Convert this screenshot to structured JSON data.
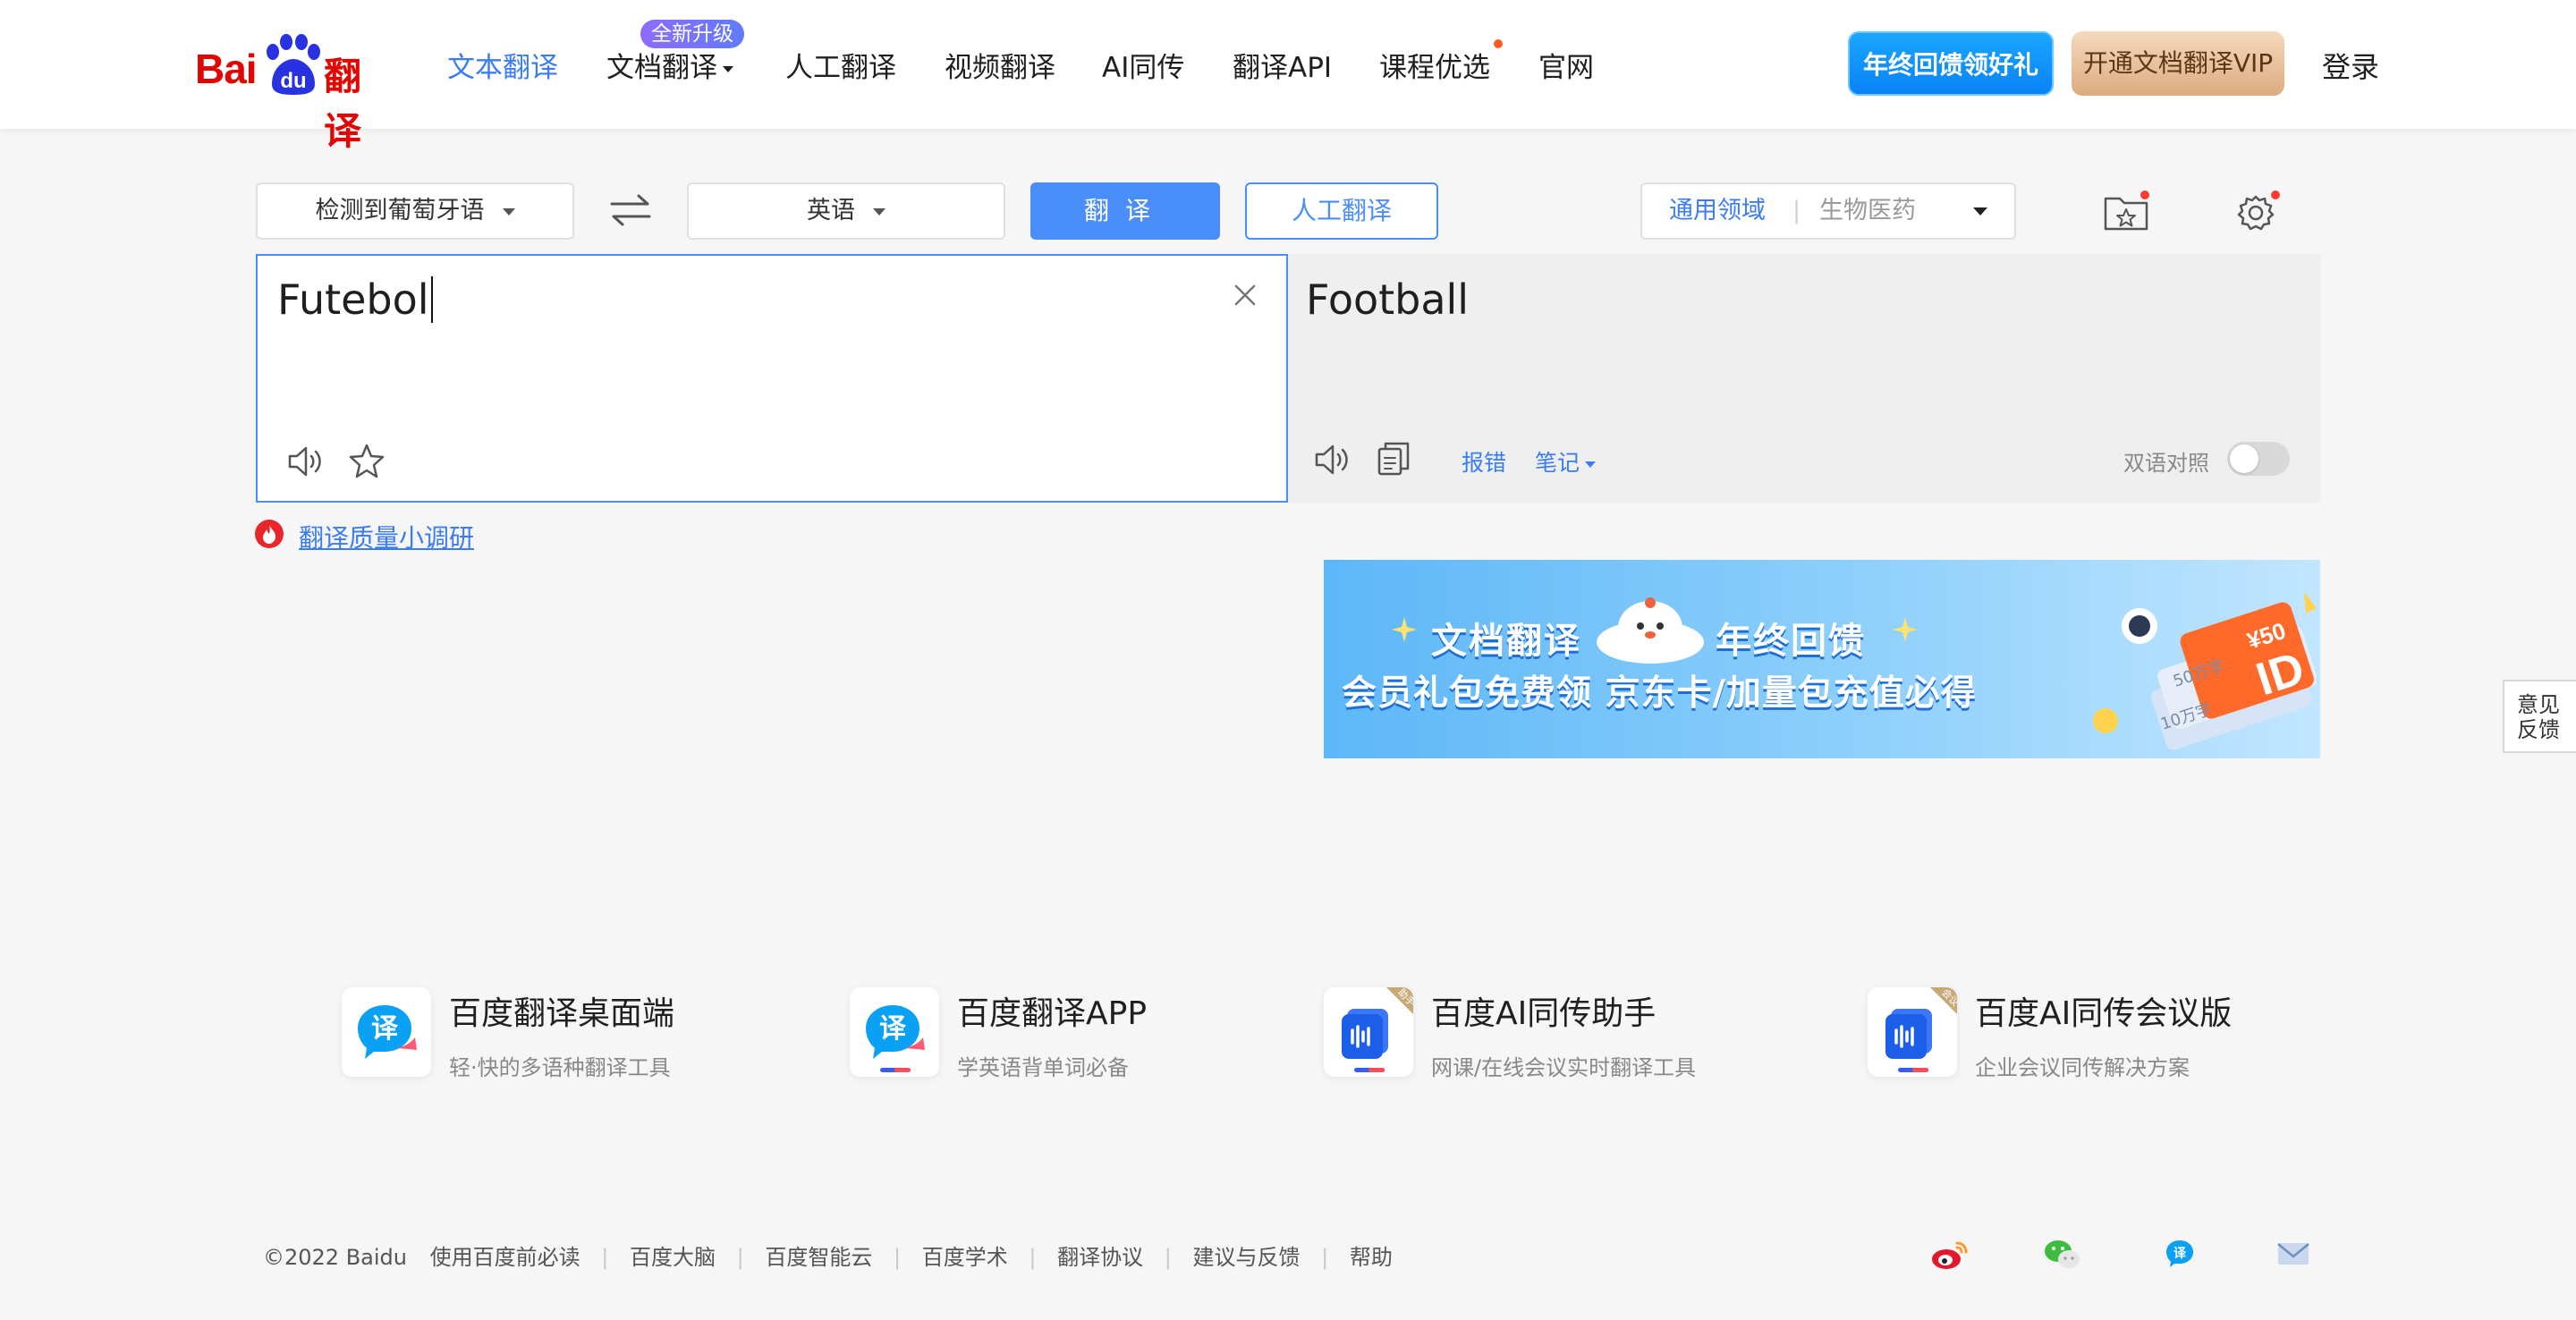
{
  "header": {
    "logo_text": "Bai",
    "logo_du": "du",
    "logo_fanyi": "翻译",
    "nav": [
      {
        "label": "文本翻译"
      },
      {
        "label": "文档翻译"
      },
      {
        "label": "人工翻译"
      },
      {
        "label": "视频翻译"
      },
      {
        "label": "AI同传"
      },
      {
        "label": "翻译API"
      },
      {
        "label": "课程优选"
      },
      {
        "label": "官网"
      }
    ],
    "upgrade_badge": "全新升级",
    "year_end_button": "年终回馈领好礼",
    "vip_button": "开通文档翻译VIP",
    "login": "登录"
  },
  "toolbar": {
    "source_language": "检测到葡萄牙语",
    "target_language": "英语",
    "translate_button": "翻译",
    "human_translate_button": "人工翻译",
    "domain_general": "通用领域",
    "domain_separator": "|",
    "domain_bio": "生物医药"
  },
  "source": {
    "text": "Futebol"
  },
  "target": {
    "text": "Football",
    "report_error": "报错",
    "notes": "笔记",
    "bilingual": "双语对照"
  },
  "survey": {
    "label": "翻译质量小调研"
  },
  "banner": {
    "line1_a": "文档翻译",
    "line1_b": "年终回馈",
    "line2": "会员礼包免费领  京东卡/加量包充值必得",
    "card_price": "¥50",
    "card_a": "50万字",
    "card_b": "10万字"
  },
  "feedback": {
    "line1": "意见",
    "line2": "反馈"
  },
  "products": [
    {
      "title": "百度翻译桌面端",
      "subtitle": "轻·快的多语种翻译工具",
      "icon": "translate-icon"
    },
    {
      "title": "百度翻译APP",
      "subtitle": "学英语背单词必备",
      "icon": "translate-icon"
    },
    {
      "title": "百度AI同传助手",
      "subtitle": "网课/在线会议实时翻译工具",
      "icon": "voice-icon",
      "tag": "助手"
    },
    {
      "title": "百度AI同传会议版",
      "subtitle": "企业会议同传解决方案",
      "icon": "voice-icon",
      "tag": "会议"
    }
  ],
  "footer": {
    "copyright": "©2022 Baidu",
    "links": [
      "使用百度前必读",
      "百度大脑",
      "百度智能云",
      "百度学术",
      "翻译协议",
      "建议与反馈",
      "帮助"
    ],
    "social": [
      "weibo-icon",
      "wechat-icon",
      "baidu-fanyi-icon",
      "mail-icon"
    ]
  },
  "colors": {
    "accent": "#3a7cf5",
    "logo_red": "#e10602",
    "logo_blue": "#2932e1"
  }
}
